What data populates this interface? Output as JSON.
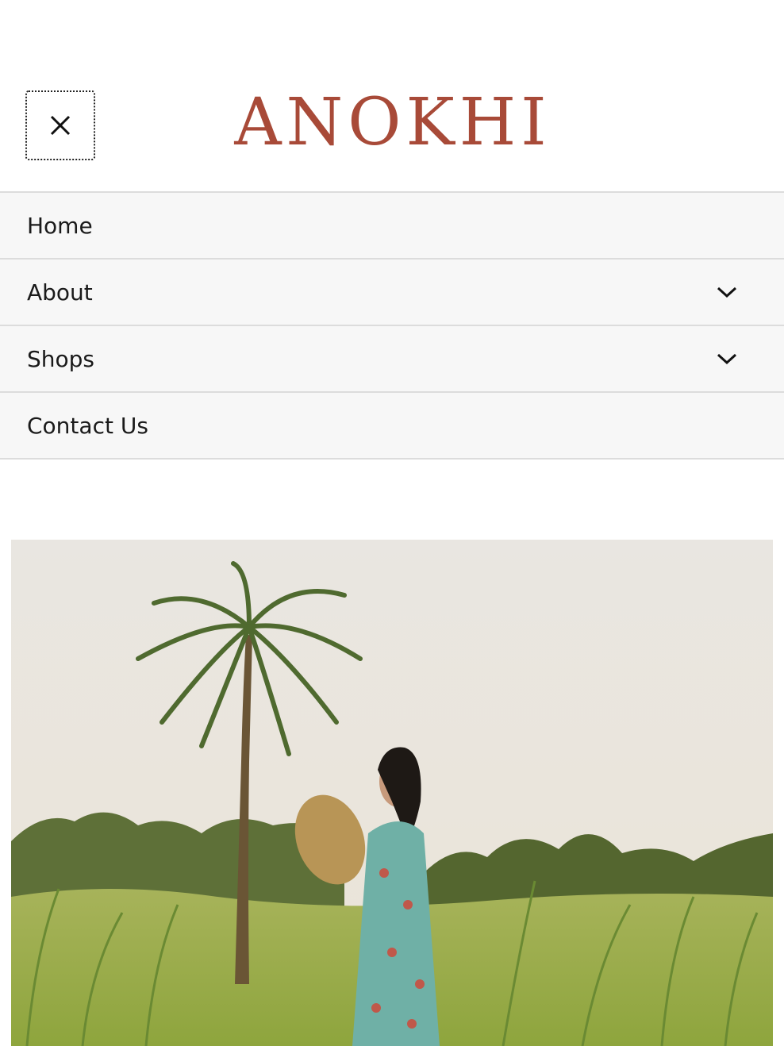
{
  "header": {
    "brand": "ANOKHI",
    "close_icon": "close-icon"
  },
  "menu": {
    "items": [
      {
        "label": "Home",
        "has_submenu": false
      },
      {
        "label": "About",
        "has_submenu": true,
        "icon": "chevron-down-icon"
      },
      {
        "label": "Shops",
        "has_submenu": true,
        "icon": "chevron-down-icon"
      },
      {
        "label": "Contact Us",
        "has_submenu": false
      }
    ]
  },
  "colors": {
    "brand": "#a84a38",
    "menu_bg": "#f7f7f7",
    "divider": "#dcdcdc"
  }
}
